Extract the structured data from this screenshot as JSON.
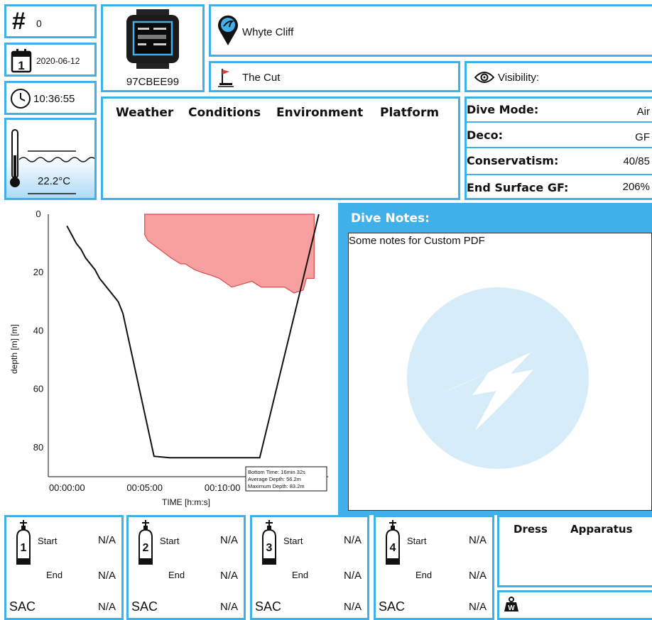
{
  "header": {
    "dive_number": "0",
    "date": "2020-06-12",
    "time": "10:36:55",
    "water_temp": "22.2°C",
    "device_serial": "97CBEE99",
    "location": "Whyte Cliff",
    "site": "The Cut",
    "visibility_label": "Visibility:",
    "env_tabs": [
      "Weather",
      "Conditions",
      "Environment",
      "Platform"
    ]
  },
  "settings": {
    "rows": [
      {
        "label": "Dive Mode:",
        "value": "Air"
      },
      {
        "label": "Deco:",
        "value": "GF"
      },
      {
        "label": "Conservatism:",
        "value": "40/85"
      },
      {
        "label": "End Surface GF:",
        "value": "206%"
      }
    ]
  },
  "notes": {
    "title": "Dive Notes:",
    "text": "Some notes for Custom PDF"
  },
  "chart_data": {
    "type": "line",
    "xlabel": "TIME [h:m:s]",
    "ylabel": "depth [m] [m]",
    "x_ticks": [
      "00:00:00",
      "00:05:00",
      "00:10:00"
    ],
    "x_tick_minutes": [
      0,
      5,
      10
    ],
    "y_ticks": [
      0,
      20,
      40,
      60,
      80
    ],
    "ylim": [
      0,
      90
    ],
    "xlim_minutes": [
      -1.2,
      16.8
    ],
    "series": [
      {
        "values_minutes_depth": [
          [
            0,
            4
          ],
          [
            0.3,
            7
          ],
          [
            0.6,
            10
          ],
          [
            0.9,
            12
          ],
          [
            1.2,
            15
          ],
          [
            1.5,
            17
          ],
          [
            1.8,
            19
          ],
          [
            2.1,
            22
          ],
          [
            2.4,
            24
          ],
          [
            2.7,
            26
          ],
          [
            3,
            28
          ],
          [
            3.3,
            30
          ],
          [
            3.6,
            34
          ],
          [
            5.6,
            83
          ],
          [
            6.6,
            83.5
          ],
          [
            12.4,
            83.5
          ],
          [
            16.2,
            0
          ]
        ],
        "type": "line"
      },
      {
        "values_minutes_depth": [
          [
            5,
            0
          ],
          [
            15.9,
            0
          ],
          [
            15.9,
            22
          ],
          [
            15.4,
            22
          ],
          [
            15.2,
            26
          ],
          [
            14.6,
            27
          ],
          [
            14.0,
            25
          ],
          [
            12.5,
            25
          ],
          [
            11.9,
            23
          ],
          [
            10.6,
            25
          ],
          [
            9.8,
            22
          ],
          [
            9.3,
            21
          ],
          [
            8.7,
            20
          ],
          [
            8.2,
            19
          ],
          [
            7.6,
            17
          ],
          [
            7.3,
            17
          ],
          [
            6.7,
            15
          ],
          [
            6.2,
            13
          ],
          [
            5.7,
            11
          ],
          [
            5.2,
            9
          ],
          [
            5.0,
            7
          ],
          [
            5,
            0
          ]
        ],
        "type": "area",
        "color": "#f7a0a0"
      }
    ],
    "annotations": [
      "Bottom Time: 16min 32s",
      "Average Depth: 56.2m",
      "Maximum Depth: 83.2m"
    ]
  },
  "tanks": [
    {
      "number": "1",
      "start_label": "Start",
      "start": "N/A",
      "end_label": "End",
      "end": "N/A",
      "sac_label": "SAC",
      "sac": "N/A"
    },
    {
      "number": "2",
      "start_label": "Start",
      "start": "N/A",
      "end_label": "End",
      "end": "N/A",
      "sac_label": "SAC",
      "sac": "N/A"
    },
    {
      "number": "3",
      "start_label": "Start",
      "start": "N/A",
      "end_label": "End",
      "end": "N/A",
      "sac_label": "SAC",
      "sac": "N/A"
    },
    {
      "number": "4",
      "start_label": "Start",
      "start": "N/A",
      "end_label": "End",
      "end": "N/A",
      "sac_label": "SAC",
      "sac": "N/A"
    }
  ],
  "gear": {
    "dress_label": "Dress",
    "apparatus_label": "Apparatus"
  },
  "colors": {
    "accent": "#3fb0ea",
    "ceiling_fill": "#f7a0a0",
    "notes_watermark": "#d7ecf9"
  },
  "icons": {
    "number": "hash-icon",
    "date": "calendar-icon",
    "time": "clock-icon",
    "temp": "thermometer-icon",
    "location": "map-pin-icon",
    "site": "flag-icon",
    "visibility": "eye-icon",
    "tank": "tank-icon",
    "weight": "weight-icon"
  }
}
